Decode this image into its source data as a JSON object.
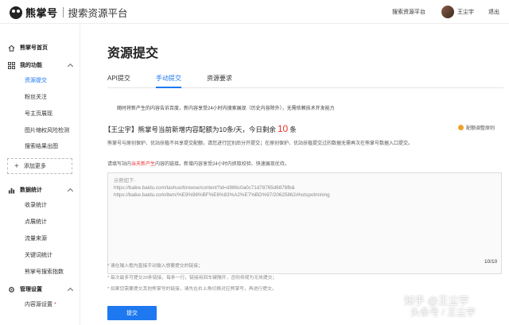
{
  "header": {
    "logo_text": "熊掌号",
    "platform_name": "搜索资源平台",
    "link": "搜索资源平台",
    "username": "王尘宇",
    "logout": "退出"
  },
  "sidebar": {
    "home": "熊掌号首页",
    "my_functions": "我的功能",
    "function_items": [
      "资源提交",
      "粉丝关注",
      "号主页展现",
      "图片缩权风险检测",
      "搜索结果出图"
    ],
    "add_more": "添加更多",
    "data_stats": "数据统计",
    "data_items": [
      "收录统计",
      "点展统计",
      "流量来源",
      "关键词统计",
      "熊掌号搜索指数"
    ],
    "management": "管理设置",
    "management_items": [
      "内容源设置"
    ]
  },
  "main": {
    "title": "资源提交",
    "tabs": [
      "API提交",
      "手动提交",
      "资源要求"
    ],
    "active_tab": "手动提交",
    "notice": "随时将新产生的内容告诉百度，新内容享受24小时内搜索展现（历史内容除外），无需依赖技术开发能力",
    "quota": {
      "prefix": "【王尘宇】熊掌号当前新增内容配额为10条/天，今日剩余",
      "remaining": "10",
      "suffix": "条"
    },
    "quota_rule": "配额调整原则",
    "description": "熊掌号与原创保护、优站扶植不共享提交配额，请您进行区别后分开提交；在原创保护、优站扶植提交过的数据无需再次在熊掌号数据入口提交。",
    "hint": {
      "prefix": "请填写站内",
      "highlight": "当天新产生",
      "suffix": "内容的链接。新增内容享受24小时内抓取校验、快速展现优待。"
    },
    "textarea": {
      "placeholder_title": "示例如下:",
      "lines": [
        "https://baike.baidu.com/tashuo/browse/content?id=d986c0a0c71d78765d6878fb&",
        "https://baike.baidu.com/item/%E9%98%BF%E6%83%A2%E7%BD%97/20625862#hotspotmining"
      ]
    },
    "char_count": "10/10",
    "rules": [
      "* 请在输入框内直接手动输入想要提交的链接；",
      "* 每次最多可提交20条链接，每条一行，链接用回车键隔开，否则将视为无效提交；",
      "* 如果您需要提交其他熊掌号的链接，请先在右上角切换对应熊掌号，再进行提交。"
    ],
    "submit": "提交"
  },
  "watermark": {
    "line1": "知乎 @王尘宇",
    "line2": "头条号 / 王尘宇"
  },
  "colors": {
    "accent": "#1e78f0",
    "highlight": "#e33333",
    "rule_dot": "#f0a030"
  }
}
